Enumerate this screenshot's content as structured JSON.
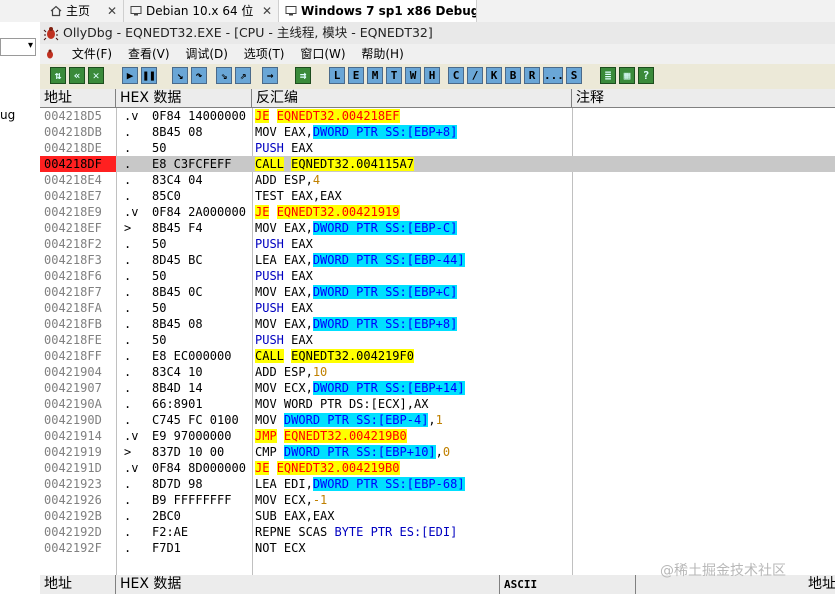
{
  "browser_tabs": [
    {
      "label": "主页",
      "icon": "home-icon",
      "active": false
    },
    {
      "label": "Debian 10.x 64 位",
      "icon": "vm-icon",
      "active": false
    },
    {
      "label": "Windows 7 sp1 x86 Debug",
      "icon": "vm-icon",
      "active": true
    }
  ],
  "left_strip": {
    "fragment": "ug"
  },
  "window": {
    "title": "OllyDbg - EQNEDT32.EXE - [CPU - 主线程, 模块 - EQNEDT32]"
  },
  "menu": [
    "文件(F)",
    "查看(V)",
    "调试(D)",
    "选项(T)",
    "窗口(W)",
    "帮助(H)"
  ],
  "toolbar": {
    "letters": [
      "L",
      "E",
      "M",
      "T",
      "W",
      "H",
      "C",
      "/",
      "K",
      "B",
      "R",
      "...",
      "S"
    ]
  },
  "cpu": {
    "headers": {
      "addr": "地址",
      "hex": "HEX 数据",
      "disasm": "反汇编",
      "comment": "注释"
    },
    "rows": [
      {
        "addr": "004218D5",
        "mark": ".v",
        "hex": "0F84 14000000",
        "mnem": "JE",
        "kind": "jcc",
        "ops": [
          {
            "t": "EQNEDT32.004218EF",
            "s": "jcc"
          }
        ]
      },
      {
        "addr": "004218DB",
        "mark": ".",
        "hex": "8B45 08",
        "mnem": "MOV",
        "kind": "plain",
        "ops": [
          {
            "t": "EAX,",
            "s": ""
          },
          {
            "t": "DWORD PTR SS:[EBP+8]",
            "s": "mem"
          }
        ]
      },
      {
        "addr": "004218DE",
        "mark": ".",
        "hex": "50",
        "mnem": "PUSH",
        "kind": "push",
        "ops": [
          {
            "t": "EAX",
            "s": ""
          }
        ]
      },
      {
        "addr": "004218DF",
        "mark": ".",
        "hex": "E8 C3FCFEFF",
        "mnem": "CALL",
        "kind": "call",
        "ops": [
          {
            "t": "EQNEDT32.004115A7",
            "s": "call"
          }
        ],
        "current": true
      },
      {
        "addr": "004218E4",
        "mark": ".",
        "hex": "83C4 04",
        "mnem": "ADD",
        "kind": "plain",
        "ops": [
          {
            "t": "ESP,",
            "s": ""
          },
          {
            "t": "4",
            "s": "num"
          }
        ]
      },
      {
        "addr": "004218E7",
        "mark": ".",
        "hex": "85C0",
        "mnem": "TEST",
        "kind": "plain",
        "ops": [
          {
            "t": "EAX,EAX",
            "s": ""
          }
        ]
      },
      {
        "addr": "004218E9",
        "mark": ".v",
        "hex": "0F84 2A000000",
        "mnem": "JE",
        "kind": "jcc",
        "ops": [
          {
            "t": "EQNEDT32.00421919",
            "s": "jcc"
          }
        ]
      },
      {
        "addr": "004218EF",
        "mark": ">",
        "hex": "8B45 F4",
        "mnem": "MOV",
        "kind": "plain",
        "ops": [
          {
            "t": "EAX,",
            "s": ""
          },
          {
            "t": "DWORD PTR SS:[EBP-C]",
            "s": "mem"
          }
        ]
      },
      {
        "addr": "004218F2",
        "mark": ".",
        "hex": "50",
        "mnem": "PUSH",
        "kind": "push",
        "ops": [
          {
            "t": "EAX",
            "s": ""
          }
        ]
      },
      {
        "addr": "004218F3",
        "mark": ".",
        "hex": "8D45 BC",
        "mnem": "LEA",
        "kind": "plain",
        "ops": [
          {
            "t": "EAX,",
            "s": ""
          },
          {
            "t": "DWORD PTR SS:[EBP-44]",
            "s": "mem"
          }
        ]
      },
      {
        "addr": "004218F6",
        "mark": ".",
        "hex": "50",
        "mnem": "PUSH",
        "kind": "push",
        "ops": [
          {
            "t": "EAX",
            "s": ""
          }
        ]
      },
      {
        "addr": "004218F7",
        "mark": ".",
        "hex": "8B45 0C",
        "mnem": "MOV",
        "kind": "plain",
        "ops": [
          {
            "t": "EAX,",
            "s": ""
          },
          {
            "t": "DWORD PTR SS:[EBP+C]",
            "s": "mem"
          }
        ]
      },
      {
        "addr": "004218FA",
        "mark": ".",
        "hex": "50",
        "mnem": "PUSH",
        "kind": "push",
        "ops": [
          {
            "t": "EAX",
            "s": ""
          }
        ]
      },
      {
        "addr": "004218FB",
        "mark": ".",
        "hex": "8B45 08",
        "mnem": "MOV",
        "kind": "plain",
        "ops": [
          {
            "t": "EAX,",
            "s": ""
          },
          {
            "t": "DWORD PTR SS:[EBP+8]",
            "s": "mem"
          }
        ]
      },
      {
        "addr": "004218FE",
        "mark": ".",
        "hex": "50",
        "mnem": "PUSH",
        "kind": "push",
        "ops": [
          {
            "t": "EAX",
            "s": ""
          }
        ]
      },
      {
        "addr": "004218FF",
        "mark": ".",
        "hex": "E8 EC000000",
        "mnem": "CALL",
        "kind": "call",
        "ops": [
          {
            "t": "EQNEDT32.004219F0",
            "s": "call"
          }
        ]
      },
      {
        "addr": "00421904",
        "mark": ".",
        "hex": "83C4 10",
        "mnem": "ADD",
        "kind": "plain",
        "ops": [
          {
            "t": "ESP,",
            "s": ""
          },
          {
            "t": "10",
            "s": "num"
          }
        ]
      },
      {
        "addr": "00421907",
        "mark": ".",
        "hex": "8B4D 14",
        "mnem": "MOV",
        "kind": "plain",
        "ops": [
          {
            "t": "ECX,",
            "s": ""
          },
          {
            "t": "DWORD PTR SS:[EBP+14]",
            "s": "mem"
          }
        ]
      },
      {
        "addr": "0042190A",
        "mark": ".",
        "hex": "66:8901",
        "mnem": "MOV",
        "kind": "plain",
        "ops": [
          {
            "t": "WORD PTR DS:[ECX],AX",
            "s": ""
          }
        ]
      },
      {
        "addr": "0042190D",
        "mark": ".",
        "hex": "C745 FC 0100",
        "mnem": "MOV",
        "kind": "plain",
        "ops": [
          {
            "t": "DWORD PTR SS:[EBP-4]",
            "s": "mem"
          },
          {
            "t": ",",
            "s": ""
          },
          {
            "t": "1",
            "s": "num"
          }
        ]
      },
      {
        "addr": "00421914",
        "mark": ".v",
        "hex": "E9 97000000",
        "mnem": "JMP",
        "kind": "jcc",
        "ops": [
          {
            "t": "EQNEDT32.004219B0",
            "s": "jcc"
          }
        ]
      },
      {
        "addr": "00421919",
        "mark": ">",
        "hex": "837D 10 00",
        "mnem": "CMP",
        "kind": "plain",
        "ops": [
          {
            "t": "DWORD PTR SS:[EBP+10]",
            "s": "mem"
          },
          {
            "t": ",",
            "s": ""
          },
          {
            "t": "0",
            "s": "num"
          }
        ]
      },
      {
        "addr": "0042191D",
        "mark": ".v",
        "hex": "0F84 8D000000",
        "mnem": "JE",
        "kind": "jcc",
        "ops": [
          {
            "t": "EQNEDT32.004219B0",
            "s": "jcc"
          }
        ]
      },
      {
        "addr": "00421923",
        "mark": ".",
        "hex": "8D7D 98",
        "mnem": "LEA",
        "kind": "plain",
        "ops": [
          {
            "t": "EDI,",
            "s": ""
          },
          {
            "t": "DWORD PTR SS:[EBP-68]",
            "s": "mem"
          }
        ]
      },
      {
        "addr": "00421926",
        "mark": ".",
        "hex": "B9 FFFFFFFF",
        "mnem": "MOV",
        "kind": "plain",
        "ops": [
          {
            "t": "ECX,",
            "s": ""
          },
          {
            "t": "-1",
            "s": "num"
          }
        ]
      },
      {
        "addr": "0042192B",
        "mark": ".",
        "hex": "2BC0",
        "mnem": "SUB",
        "kind": "plain",
        "ops": [
          {
            "t": "EAX,EAX",
            "s": ""
          }
        ]
      },
      {
        "addr": "0042192D",
        "mark": ".",
        "hex": "F2:AE",
        "mnem": "REPNE",
        "kind": "plain",
        "ops": [
          {
            "t": "SCAS ",
            "s": ""
          },
          {
            "t": "BYTE PTR ES:[EDI]",
            "s": "bytemem"
          }
        ]
      },
      {
        "addr": "0042192F",
        "mark": ".",
        "hex": "F7D1",
        "mnem": "NOT",
        "kind": "plain",
        "ops": [
          {
            "t": "ECX",
            "s": ""
          }
        ]
      }
    ]
  },
  "dump": {
    "headers": {
      "addr": "地址",
      "hex": "HEX 数据",
      "ascii": "ASCII",
      "addr2": "地址"
    }
  },
  "watermark": "@稀土掘金技术社区",
  "colors": {
    "current_eip": "#ff2020",
    "jump_highlight": "#ffff00",
    "memory_operand": "#00e0ff"
  }
}
